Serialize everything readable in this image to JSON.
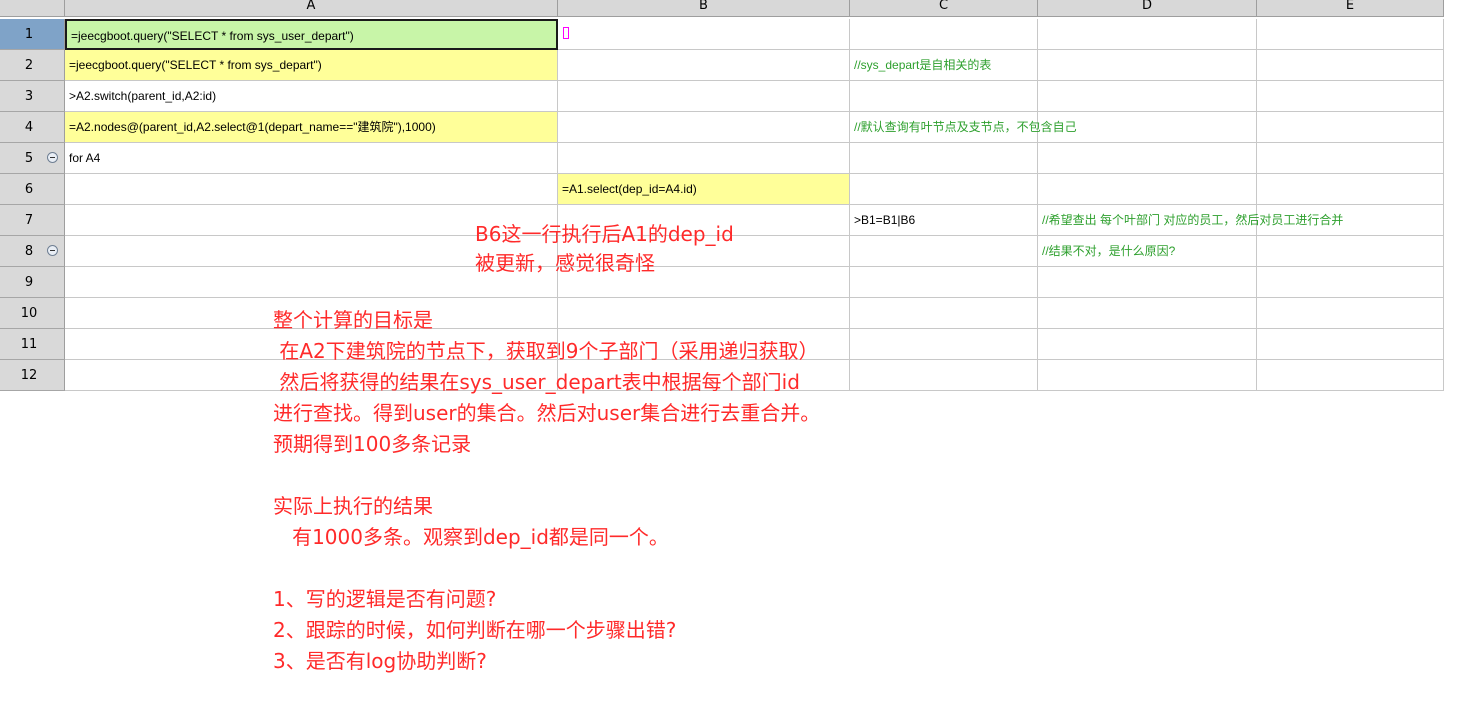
{
  "columns": [
    "A",
    "B",
    "C",
    "D",
    "E"
  ],
  "rows": [
    "1",
    "2",
    "3",
    "4",
    "5",
    "6",
    "7",
    "8",
    "9",
    "10",
    "11",
    "12"
  ],
  "cells": {
    "A1": "=jeecgboot.query(\"SELECT * from sys_user_depart\")",
    "A2": "=jeecgboot.query(\"SELECT * from sys_depart\")",
    "C2": "//sys_depart是自相关的表",
    "A3": ">A2.switch(parent_id,A2:id)",
    "A4": "=A2.nodes@(parent_id,A2.select@1(depart_name==\"建筑院\"),1000)",
    "C4": "//默认查询有叶节点及支节点，不包含自己",
    "A5": "for A4",
    "B6": "=A1.select(dep_id=A4.id)",
    "C7": ">B1=B1|B6",
    "D7": "//希望查出 每个叶部门 对应的员工，然后对员工进行合并",
    "D8": "//结果不对，是什么原因?"
  },
  "annotation_top": "B6这一行执行后A1的dep_id\n被更新，感觉很奇怪",
  "annotation_main": "整个计算的目标是\n 在A2下建筑院的节点下，获取到9个子部门（采用递归获取）\n 然后将获得的结果在sys_user_depart表中根据每个部门id\n进行查找。得到user的集合。然后对user集合进行去重合并。\n预期得到100多条记录\n\n实际上执行的结果\n   有1000多条。观察到dep_id都是同一个。\n\n1、写的逻辑是否有问题?\n2、跟踪的时候，如何判断在哪一个步骤出错?\n3、是否有log协助判断?",
  "colors": {
    "green_cell": "#c8f5a8",
    "yellow_cell": "#ffff99",
    "comment_text": "#2ea02e",
    "annotation_text": "#ff2a2a",
    "active_row_header": "#7fa3c8"
  },
  "icons": [
    "collapse-icon"
  ]
}
